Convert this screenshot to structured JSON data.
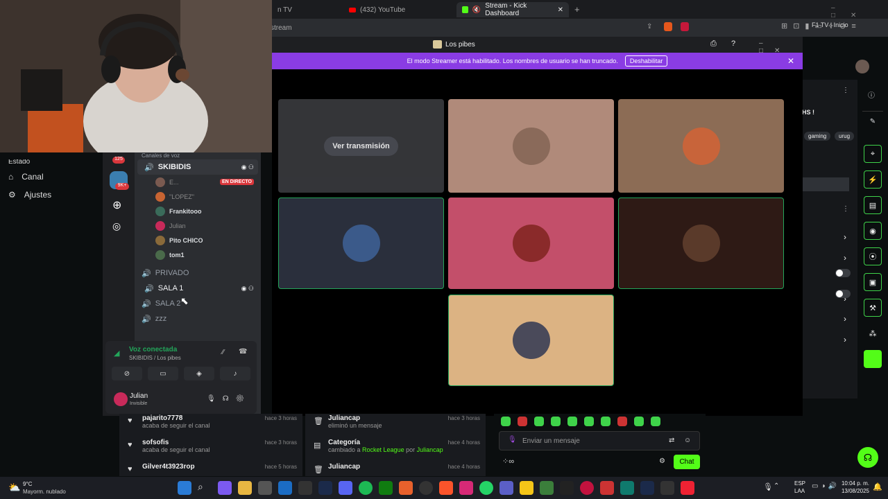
{
  "browser": {
    "tabs": [
      {
        "label": "n TV"
      },
      {
        "label": "(432) YouTube"
      },
      {
        "label": "Stream - Kick Dashboard"
      }
    ],
    "url_fragment": "stream",
    "right_link": "F1 TV | Inicio"
  },
  "kick_sidebar": {
    "partial_label": "Estado",
    "items": [
      {
        "label": "Canal",
        "icon": "home-icon"
      },
      {
        "label": "Ajustes",
        "icon": "gear-icon"
      }
    ]
  },
  "discord": {
    "window_title": "Los pibes",
    "banner": {
      "text": "El modo Streamer está habilitado. Los nombres de usuario se han truncado.",
      "button": "Deshabilitar"
    },
    "guild_badges": [
      "125",
      "9K+"
    ],
    "section_header": "Canales de voz",
    "channels": [
      {
        "name": "SKIBIDIS",
        "selected": true
      },
      {
        "name": "PRIVADO"
      },
      {
        "name": "SALA 1",
        "hover": true
      },
      {
        "name": "SALA 2"
      },
      {
        "name": "zzz"
      }
    ],
    "skibidis_users": [
      {
        "name": "E...",
        "badge": "EN DIRECTO",
        "color": "#7a5a50"
      },
      {
        "name": "\"LOPEZ\"",
        "color": "#c86432"
      },
      {
        "name": "Frankitooo",
        "color": "#3a6b5a"
      },
      {
        "name": "Julian",
        "color": "#c82a5a"
      },
      {
        "name": "Pito CHICO",
        "color": "#8a6a3a"
      },
      {
        "name": "tom1",
        "color": "#4a6a4a"
      }
    ],
    "voice": {
      "status": "Voz conectada",
      "location": "SKIBIDIS / Los pibes"
    },
    "user": {
      "name": "Julian",
      "status": "Invisible"
    },
    "watch_stream": "Ver transmisión",
    "tile_colors": [
      "#b08a7a",
      "#8c6c55",
      "#2a2f3c",
      "#c34f6a",
      "#2e1a15",
      "#dcb383"
    ]
  },
  "activity": [
    {
      "name": "pajarito7778",
      "sub": "acaba de seguir el canal",
      "time": "hace 3 horas"
    },
    {
      "name": "sofsofis",
      "sub": "acaba de seguir el canal",
      "time": "hace 3 horas"
    },
    {
      "name": "Gilver4t3923rop",
      "time": "hace 5 horas"
    }
  ],
  "activity2": [
    {
      "name": "Juliancap",
      "sub": "eliminó un mensaje",
      "time": "hace 3 horas"
    },
    {
      "name": "Categoría",
      "sub_pre": "cambiado a ",
      "sub_cat": "Rocket League",
      "sub_mid": " por ",
      "sub_user": "Juliancap",
      "time": "hace 4 horas"
    },
    {
      "name": "Juliancap",
      "time": "hace 4 horas"
    }
  ],
  "chat": {
    "placeholder": "Enviar un mensaje",
    "button": "Chat"
  },
  "right_panel": {
    "partial_text": "HS !",
    "tags": [
      "gaming",
      "urug"
    ]
  },
  "taskbar": {
    "weather_temp": "9°C",
    "weather_desc": "Mayorm. nublado",
    "lang": "ESP",
    "lang2": "LAA",
    "time": "10:04 p. m.",
    "date": "13/08/2025"
  }
}
